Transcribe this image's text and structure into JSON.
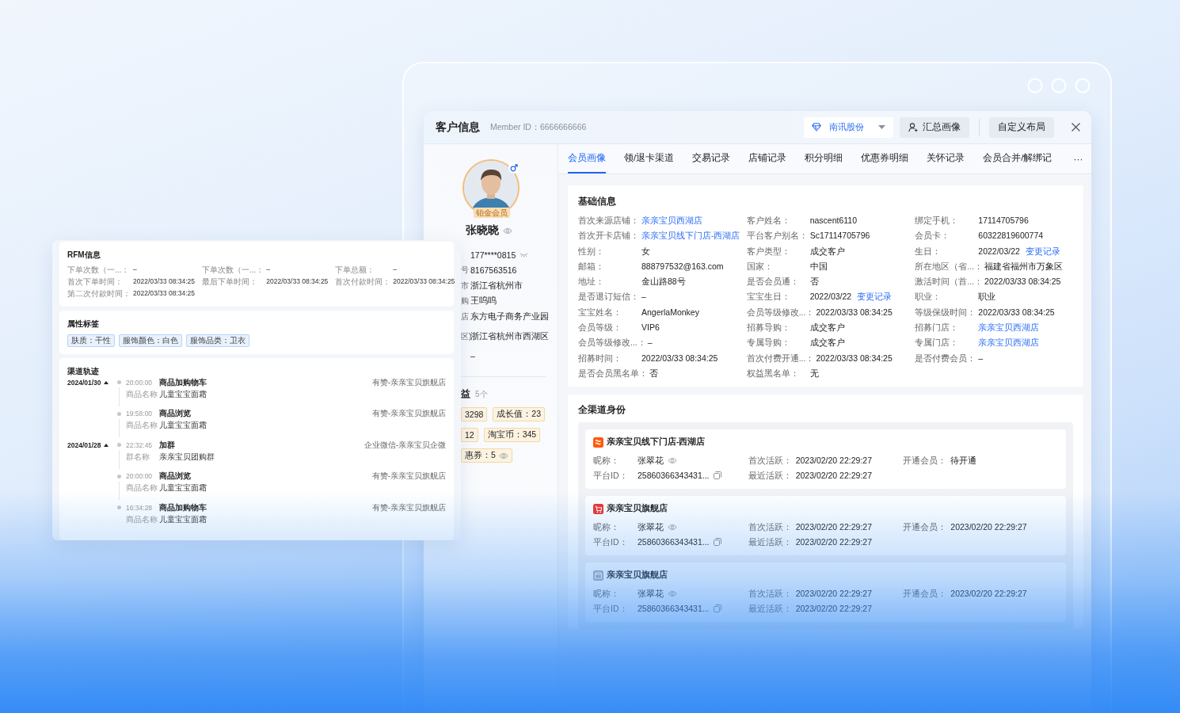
{
  "header": {
    "title": "客户信息",
    "member_id": "Member ID：6666666666",
    "org_select": {
      "value": "南讯股份"
    },
    "buttons": [
      {
        "label": "汇总画像"
      },
      {
        "label": "自定义布局"
      }
    ]
  },
  "profile": {
    "badge": "铂金会员",
    "name": "张晓晓",
    "fields": [
      {
        "value": "177****0815"
      },
      {
        "label": "号",
        "value": "8167563516"
      },
      {
        "label": "市",
        "value": "浙江省杭州市"
      },
      {
        "label": "购",
        "value": "王呜呜"
      },
      {
        "label": "店",
        "value": "东方电子商务产业园"
      },
      {
        "label": "区)",
        "value": "浙江省杭州市西湖区"
      },
      {
        "value": "–"
      }
    ],
    "benefits": {
      "title": "益",
      "count": "5个",
      "chips": [
        {
          "text": "3298"
        },
        {
          "text": "成长值：23"
        },
        {
          "text": "12"
        },
        {
          "text": "淘宝币：345"
        },
        {
          "text": "惠券：5"
        }
      ]
    }
  },
  "tabs": [
    {
      "label": "会员画像",
      "selected": true
    },
    {
      "label": "领/退卡渠道",
      "selected": false
    },
    {
      "label": "交易记录",
      "selected": false
    },
    {
      "label": "店铺记录",
      "selected": false
    },
    {
      "label": "积分明细",
      "selected": false
    },
    {
      "label": "优惠券明细",
      "selected": false
    },
    {
      "label": "关怀记录",
      "selected": false
    },
    {
      "label": "会员合并/解绑记",
      "selected": false
    }
  ],
  "tabs_more": "···",
  "basic_info": {
    "title": "基础信息",
    "rows": [
      [
        {
          "label": "首次来源店铺：",
          "value": "亲亲宝贝西湖店",
          "link": true
        },
        {
          "label": "客户姓名：",
          "value": "nascent6110",
          "link": false
        },
        {
          "label": "绑定手机：",
          "value": "17114705796",
          "link": false
        }
      ],
      [
        {
          "label": "首次开卡店铺：",
          "value": "亲亲宝贝线下门店-西湖店",
          "link": true
        },
        {
          "label": "平台客户别名：",
          "value": "Sc17114705796",
          "link": false
        },
        {
          "label": "会员卡：",
          "value": "60322819600774",
          "link": false
        }
      ],
      [
        {
          "label": "性别：",
          "value": "女",
          "link": false
        },
        {
          "label": "客户类型：",
          "value": "成交客户",
          "link": false
        },
        {
          "label": "生日：",
          "value": "2022/03/22",
          "link": false,
          "action": "变更记录"
        }
      ],
      [
        {
          "label": "邮箱：",
          "value": "888797532@163.com",
          "link": false
        },
        {
          "label": "国家：",
          "value": "中国",
          "link": false
        },
        {
          "label": "所在地区（省...：",
          "value": "福建省福州市万象区",
          "link": false
        }
      ],
      [
        {
          "label": "地址：",
          "value": "金山路88号",
          "link": false
        },
        {
          "label": "是否会员通：",
          "value": "否",
          "link": false
        },
        {
          "label": "激活时间（首...：",
          "value": "2022/03/33 08:34:25",
          "link": false
        }
      ],
      [
        {
          "label": "是否退订短信：",
          "value": "–",
          "link": false
        },
        {
          "label": "宝宝生日：",
          "value": "2022/03/22",
          "link": false,
          "action": "变更记录"
        },
        {
          "label": "职业：",
          "value": "职业",
          "link": false
        }
      ],
      [
        {
          "label": "宝宝姓名：",
          "value": "AngerlaMonkey",
          "link": false
        },
        {
          "label": "会员等级修改...：",
          "value": "2022/03/33 08:34:25",
          "link": false
        },
        {
          "label": "等级保级时间：",
          "value": "2022/03/33 08:34:25",
          "link": false
        }
      ],
      [
        {
          "label": "会员等级：",
          "value": "VIP6",
          "link": false
        },
        {
          "label": "招募导购：",
          "value": "成交客户",
          "link": false
        },
        {
          "label": "招募门店：",
          "value": "亲亲宝贝西湖店",
          "link": true
        }
      ],
      [
        {
          "label": "会员等级修改...：",
          "value": "–",
          "link": false
        },
        {
          "label": "专属导购：",
          "value": "成交客户",
          "link": false
        },
        {
          "label": "专属门店：",
          "value": "亲亲宝贝西湖店",
          "link": true
        }
      ],
      [
        {
          "label": "招募时间：",
          "value": "2022/03/33 08:34:25",
          "link": false
        },
        {
          "label": "首次付费开通...：",
          "value": "2022/03/33 08:34:25",
          "link": false
        },
        {
          "label": "是否付费会员：",
          "value": "–",
          "link": false
        }
      ],
      [
        {
          "label": "是否会员黑名单：",
          "value": "否",
          "link": false
        },
        {
          "label": "权益黑名单：",
          "value": "无",
          "link": false
        }
      ]
    ]
  },
  "channel_identity": {
    "title": "全渠道身份",
    "stores": [
      {
        "name": "亲亲宝贝线下门店-西湖店",
        "fields": [
          {
            "label": "昵称：",
            "value": "张翠花"
          },
          {
            "label": "首次活跃：",
            "value": "2023/02/20 22:29:27"
          },
          {
            "label": "开通会员：",
            "value": "待开通"
          },
          {
            "label": "平台ID：",
            "value": "25860366343431..."
          },
          {
            "label": "最近活跃：",
            "value": "2023/02/20 22:29:27"
          }
        ]
      },
      {
        "name": "亲亲宝贝旗舰店",
        "fields": [
          {
            "label": "昵称：",
            "value": "张翠花"
          },
          {
            "label": "首次活跃：",
            "value": "2023/02/20 22:29:27"
          },
          {
            "label": "开通会员：",
            "value": "2023/02/20 22:29:27"
          },
          {
            "label": "平台ID：",
            "value": "25860366343431..."
          },
          {
            "label": "最近活跃：",
            "value": "2023/02/20 22:29:27"
          }
        ]
      },
      {
        "name": "亲亲宝贝旗舰店",
        "fields": [
          {
            "label": "昵称：",
            "value": "张翠花"
          },
          {
            "label": "首次活跃：",
            "value": "2023/02/20 22:29:27"
          },
          {
            "label": "开通会员：",
            "value": "2023/02/20 22:29:27"
          },
          {
            "label": "平台ID：",
            "value": "25860366343431..."
          },
          {
            "label": "最近活跃：",
            "value": "2023/02/20 22:29:27"
          }
        ]
      }
    ]
  },
  "rfm_panel": {
    "rfm": {
      "title": "RFM信息",
      "rows": [
        [
          {
            "label": "下单次数（一...：",
            "value": "–"
          },
          {
            "label": "下单次数（一...：",
            "value": "–"
          },
          {
            "label": "下单总额：",
            "value": "–"
          }
        ],
        [
          {
            "label": "首次下单时间：",
            "value": "2022/03/33 08:34:25"
          },
          {
            "label": "最后下单时间：",
            "value": "2022/03/33 08:34:25"
          },
          {
            "label": "首次付款时间：",
            "value": "2022/03/33 08:34:25"
          }
        ],
        [
          {
            "label": "第二次付款时间：",
            "value": "2022/03/33 08:34:25"
          }
        ]
      ]
    },
    "tags": {
      "title": "属性标签",
      "items": [
        "肤质：干性",
        "服饰颜色：白色",
        "服饰品类：卫衣"
      ]
    },
    "track": {
      "title": "渠道轨迹",
      "groups": [
        {
          "date": "2024/01/30",
          "expanded": true,
          "events": [
            {
              "time": "20:00:00",
              "title": "商品加购物车",
              "detail_label": "商品名称",
              "detail_value": "儿童宝宝面霜",
              "source": "有赞-亲亲宝贝旗舰店"
            },
            {
              "time": "19:58:00",
              "title": "商品浏览",
              "detail_label": "商品名称",
              "detail_value": "儿童宝宝面霜",
              "source": "有赞-亲亲宝贝旗舰店"
            }
          ]
        },
        {
          "date": "2024/01/28",
          "expanded": true,
          "events": [
            {
              "time": "22:32:45",
              "title": "加群",
              "detail_label": "群名称",
              "detail_value": "亲亲宝贝团购群",
              "source": "企业微信-亲亲宝贝企微"
            },
            {
              "time": "20:00:00",
              "title": "商品浏览",
              "detail_label": "商品名称",
              "detail_value": "儿童宝宝面霜",
              "source": "有赞-亲亲宝贝旗舰店"
            },
            {
              "time": "16:34:28",
              "title": "商品加购物车",
              "detail_label": "商品名称",
              "detail_value": "儿童宝宝面霜",
              "source": "有赞-亲亲宝贝旗舰店"
            }
          ]
        }
      ]
    }
  }
}
